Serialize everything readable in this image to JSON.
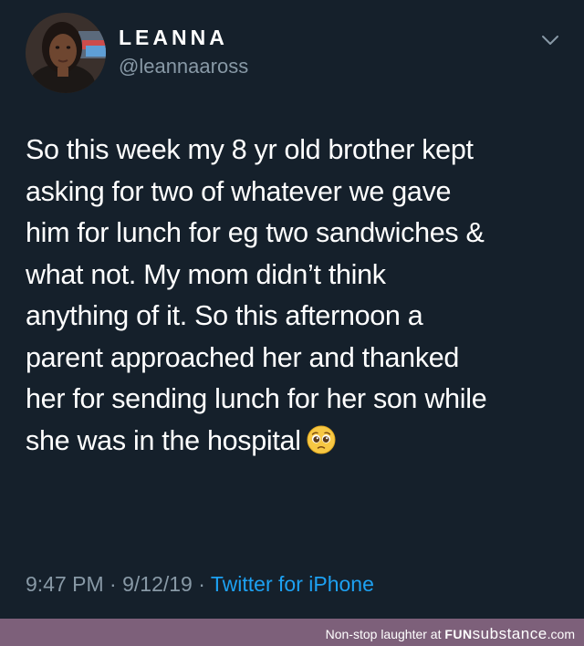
{
  "tweet": {
    "author": {
      "display_name": "LEANNA",
      "handle": "@leannaaross",
      "avatar_icon": "profile-photo"
    },
    "menu_icon": "chevron-down-icon",
    "text_lines": [
      "So this week my 8 yr old brother kept",
      "asking for two of whatever we gave",
      "him for lunch for eg two sandwiches &",
      "what not. My mom didn’t think",
      "anything of it. So this afternoon a",
      "parent approached her and thanked",
      "her for sending lunch for her son while",
      "she was in the hospital"
    ],
    "emoji": "pleading-face-emoji",
    "time": "9:47 PM",
    "separator": "·",
    "date": "9/12/19",
    "source": "Twitter for iPhone"
  },
  "watermark": {
    "prefix": "Non-stop laughter at",
    "brand_bold": "FUN",
    "brand_regular": "substance",
    "brand_suffix": ".com"
  },
  "colors": {
    "background": "#15202b",
    "text": "#ffffff",
    "muted": "#8899a6",
    "link": "#1da1f2",
    "watermark_bar": "#7d607a"
  }
}
